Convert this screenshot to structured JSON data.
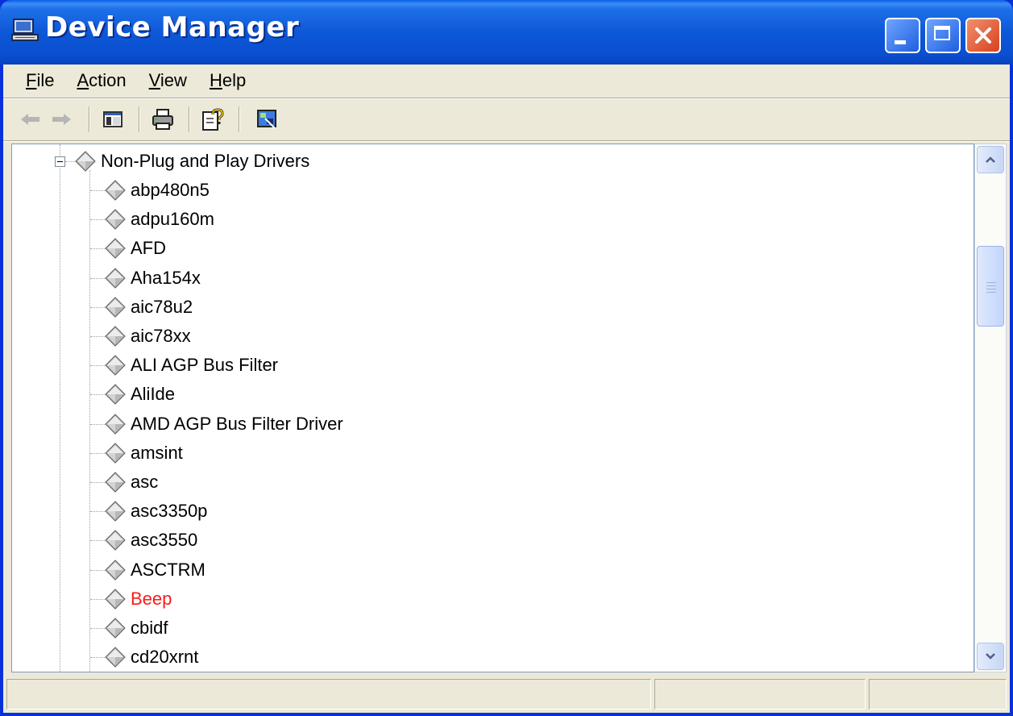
{
  "window": {
    "title": "Device Manager"
  },
  "menu": [
    {
      "accel": "F",
      "rest": "ile"
    },
    {
      "accel": "A",
      "rest": "ction"
    },
    {
      "accel": "V",
      "rest": "iew"
    },
    {
      "accel": "H",
      "rest": "elp"
    }
  ],
  "toolbar": {
    "buttons": [
      "back-icon",
      "forward-icon",
      "show-hide-console-tree-icon",
      "print-icon",
      "help-icon",
      "properties-icon"
    ]
  },
  "tree": {
    "category": "Non-Plug and Play Drivers",
    "items": [
      {
        "label": "abp480n5"
      },
      {
        "label": "adpu160m"
      },
      {
        "label": "AFD"
      },
      {
        "label": "Aha154x"
      },
      {
        "label": "aic78u2"
      },
      {
        "label": "aic78xx"
      },
      {
        "label": "ALI AGP Bus Filter"
      },
      {
        "label": "AliIde"
      },
      {
        "label": "AMD AGP Bus Filter Driver"
      },
      {
        "label": "amsint"
      },
      {
        "label": "asc"
      },
      {
        "label": "asc3350p"
      },
      {
        "label": "asc3550"
      },
      {
        "label": "ASCTRM"
      },
      {
        "label": "Beep",
        "status": "error"
      },
      {
        "label": "cbidf"
      },
      {
        "label": "cd20xrnt"
      }
    ]
  },
  "colors": {
    "titlebar": "#0a4fcf",
    "error_text": "#ff1a1a",
    "face": "#ece9d8"
  }
}
